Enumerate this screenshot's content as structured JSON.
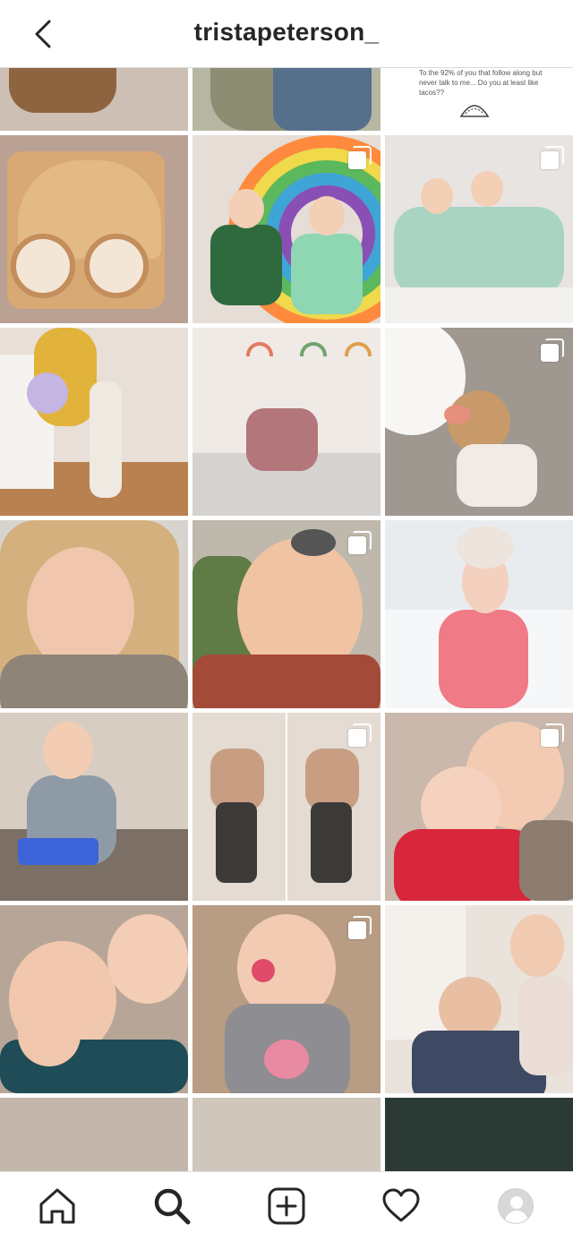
{
  "header": {
    "title": "tristapeterson_",
    "back_icon": "chevron-left-icon"
  },
  "grid": {
    "text_post": {
      "text": "To the 92% of you that follow along but never talk to me... Do you at least like tacos??",
      "icon": "taco-icon"
    },
    "tiles": [
      {
        "id": "r0c0",
        "multi": false
      },
      {
        "id": "r0c1",
        "multi": false
      },
      {
        "id": "r0c2",
        "multi": false,
        "kind": "text"
      },
      {
        "id": "r1c0",
        "multi": false
      },
      {
        "id": "r1c1",
        "multi": true
      },
      {
        "id": "r1c2",
        "multi": true
      },
      {
        "id": "r2c0",
        "multi": false
      },
      {
        "id": "r2c1",
        "multi": false
      },
      {
        "id": "r2c2",
        "multi": true
      },
      {
        "id": "r3c0",
        "multi": false
      },
      {
        "id": "r3c1",
        "multi": true
      },
      {
        "id": "r3c2",
        "multi": false
      },
      {
        "id": "r4c0",
        "multi": false
      },
      {
        "id": "r4c1",
        "multi": true
      },
      {
        "id": "r4c2",
        "multi": true
      },
      {
        "id": "r5c0",
        "multi": false
      },
      {
        "id": "r5c1",
        "multi": true
      },
      {
        "id": "r5c2",
        "multi": false
      }
    ]
  },
  "bottom_nav": {
    "items": [
      "home-icon",
      "search-icon",
      "new-post-icon",
      "heart-icon",
      "profile-avatar"
    ]
  },
  "colors": {
    "text_primary": "#262626",
    "divider": "#dbdbdb",
    "background": "#ffffff"
  }
}
